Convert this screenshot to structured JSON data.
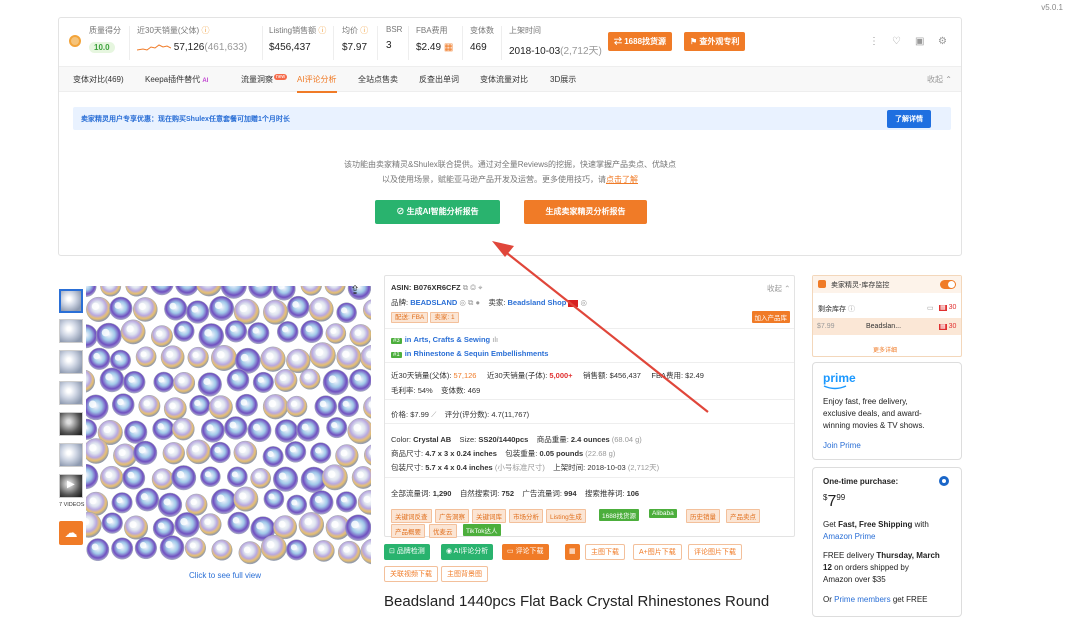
{
  "version": "v5.0.1",
  "stats": {
    "quality_label": "质量得分",
    "quality_value": "10.0",
    "sales30_label": "近30天销量(父体)",
    "sales30_value": "57,126",
    "sales30_sub": "(461,633)",
    "listing_sales_label": "Listing销售额",
    "listing_sales_value": "$456,437",
    "avg_price_label": "均价",
    "avg_price_value": "$7.97",
    "bsr_label": "BSR",
    "bsr_value": "3",
    "fba_label": "FBA费用",
    "fba_value": "$2.49",
    "variants_label": "变体数",
    "variants_value": "469",
    "listed_label": "上架时间",
    "listed_value": "2018-10-03",
    "listed_sub": "(2,712天)",
    "btn_1688": "1688找货源",
    "btn_patent": "查外观专利"
  },
  "tabs": [
    "变体对比(469)",
    "Keepa插件替代",
    "流量洞察",
    "AI评论分析",
    "全站点售卖",
    "反查出单词",
    "变体流量对比",
    "3D展示"
  ],
  "tab_new_badge": "new",
  "tab_ai_badge": "AI",
  "collapse_label": "收起",
  "promo": {
    "text": "卖家精灵用户专享优惠：现在购买Shulex任意套餐可加赠1个月时长",
    "button": "了解详情"
  },
  "description": {
    "line1": "该功能由卖家精灵&Shulex联合提供。通过对全量Reviews的挖掘，快速掌握产品卖点、优缺点",
    "line2": "以及使用场景，赋能亚马逊产品开发及运营。更多使用技巧，请",
    "link": "点击了解"
  },
  "btn_ai_report": "生成AI智能分析报告",
  "btn_seller_report": "生成卖家精灵分析报告",
  "gallery": {
    "videos": "7 VIDEOS",
    "caption": "Click to see full view"
  },
  "product": {
    "asin_label": "ASIN:",
    "asin": "B076XR6CFZ",
    "collapse": "收起",
    "brand_label": "品牌:",
    "brand": "BEADSLAND",
    "seller_label": "卖家:",
    "seller": "Beadsland Shop",
    "delivery": "配送: FBA",
    "sellers_count": "卖家: 1",
    "add_btn": "加入产品库",
    "rank1_no": "#3",
    "rank1_in": "in",
    "rank1_cat": "Arts, Crafts & Sewing",
    "rank2_no": "#1",
    "rank2_in": "in",
    "rank2_cat": "Rhinestone & Sequin Embellishments",
    "s30_parent_label": "近30天销量(父体):",
    "s30_parent": "57,126",
    "s30_child_label": "近30天销量(子体):",
    "s30_child": "5,000+",
    "revenue_label": "销售额:",
    "revenue": "$456,437",
    "fba_label": "FBA费用:",
    "fba": "$2.49",
    "margin_label": "毛利率:",
    "margin": "54%",
    "variants_label": "变体数:",
    "variants": "469",
    "price_label": "价格:",
    "price": "$7.99",
    "rating_label": "评分(评分数):",
    "rating": "4.7(11,767)",
    "color_label": "Color:",
    "color": "Crystal AB",
    "size_label": "Size:",
    "size": "SS20/1440pcs",
    "weight_label": "商品重量:",
    "weight": "2.4 ounces",
    "weight_g": "(68.04 g)",
    "dim_label": "商品尺寸:",
    "dim": "4.7 x 3 x 0.24 inches",
    "pkg_weight_label": "包装重量:",
    "pkg_weight": "0.05 pounds",
    "pkg_weight_g": "(22.68 g)",
    "pkg_dim_label": "包装尺寸:",
    "pkg_dim": "5.7 x 4 x 0.4 inches",
    "pkg_dim_note": "(小号标准尺寸)",
    "listed_label": "上架时间:",
    "listed": "2018-10-03",
    "listed_days": "(2,712天)",
    "kw_all_label": "全部流量词:",
    "kw_all": "1,290",
    "kw_organic_label": "自然搜索词:",
    "kw_organic": "752",
    "kw_ad_label": "广告流量词:",
    "kw_ad": "994",
    "kw_rec_label": "搜索推荐词:",
    "kw_rec": "106",
    "tags": [
      "关键词反查",
      "广告洞察",
      "关键词库",
      "市场分析",
      "Listing生成",
      "1688找货源",
      "Alibaba",
      "历史销量",
      "产品卖点",
      "产品概要",
      "优麦云",
      "TikTok达人"
    ],
    "actions": [
      "品牌检测",
      "AI评论分析",
      "评论下载",
      "",
      "主图下载",
      "A+图片下载",
      "评论图片下载",
      "关联视频下载",
      "主图背景图"
    ],
    "title": "Beadsland 1440pcs Flat Back Crystal Rhinestones Round"
  },
  "monitor": {
    "title": "卖家精灵-库存监控",
    "stock_label": "剩余库存",
    "stock_value": "30",
    "price": "$7.99",
    "seller": "Beadslan...",
    "qty": "30",
    "more": "更多详细"
  },
  "prime_card": {
    "logo": "prime",
    "text1": "Enjoy fast, free delivery,",
    "text2": "exclusive deals, and award-",
    "text3": "winning movies & TV shows.",
    "link": "Join Prime"
  },
  "purchase_card": {
    "label": "One-time purchase:",
    "currency": "$",
    "whole": "7",
    "frac": "99",
    "get": "Get",
    "fast": "Fast, Free Shipping",
    "with": "with",
    "amazon_prime": "Amazon Prime",
    "free_delivery": "FREE delivery",
    "date": "Thursday, March",
    "date2": "12",
    "on_orders": "on orders shipped by",
    "over": "Amazon over $35",
    "or": "Or",
    "members": "Prime members",
    "get_free": "get FREE"
  },
  "colors": {
    "accent": "#f07b27",
    "green": "#29b36e",
    "blue": "#2a6fd6",
    "arrow": "#e0463a"
  }
}
